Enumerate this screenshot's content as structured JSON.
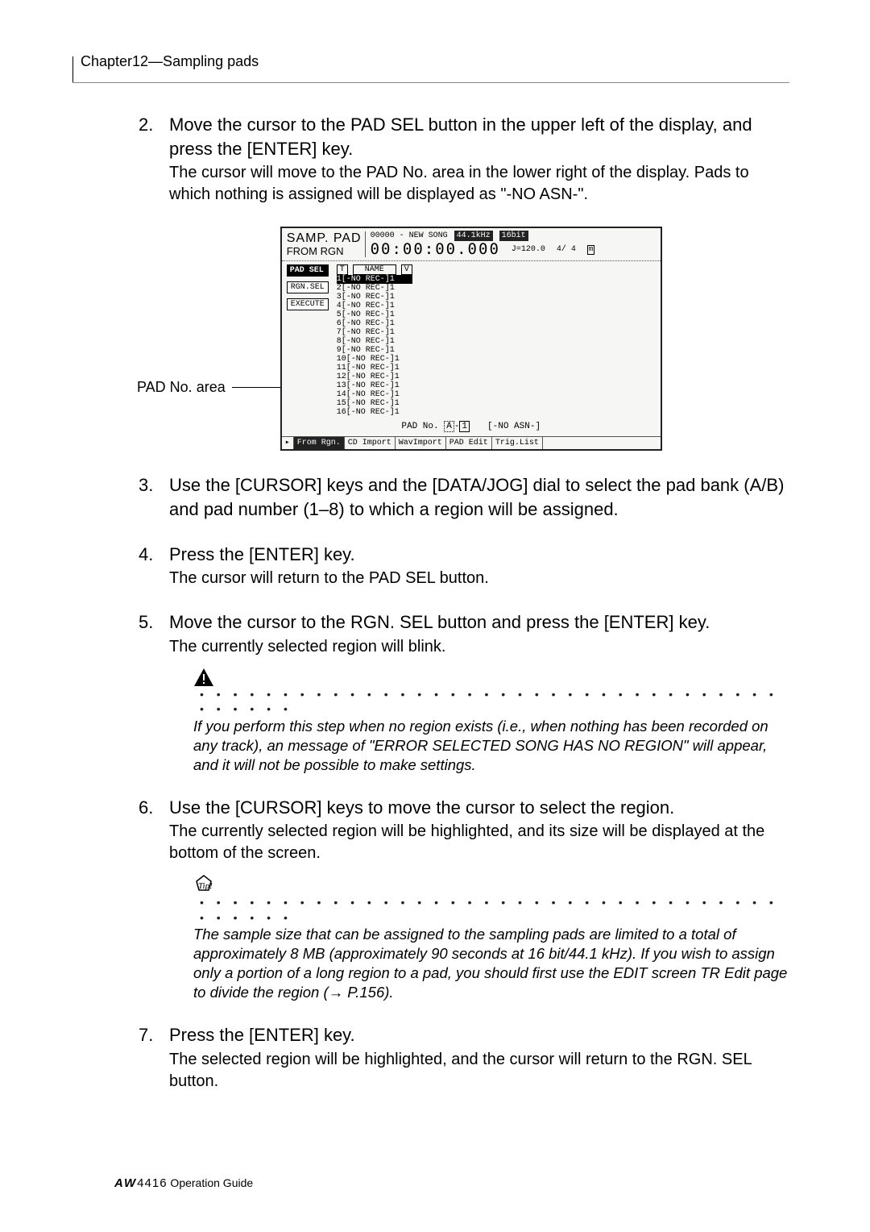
{
  "header": {
    "chapter": "Chapter12—Sampling pads"
  },
  "steps": {
    "s2": {
      "num": "2.",
      "head": "Move the cursor to the PAD SEL button in the upper left of the display, and press the [ENTER] key.",
      "body": "The cursor will move to the PAD No. area in the lower right of the display. Pads to which nothing is assigned will be displayed as \"-NO ASN-\"."
    },
    "s3": {
      "num": "3.",
      "head": "Use the [CURSOR] keys and the [DATA/JOG] dial to select the pad bank (A/B) and pad number (1–8) to which a region will be assigned."
    },
    "s4": {
      "num": "4.",
      "head": "Press the [ENTER] key.",
      "body": "The cursor will return to the PAD SEL button."
    },
    "s5": {
      "num": "5.",
      "head": "Move the cursor to the RGN. SEL button and press the [ENTER] key.",
      "body": "The currently selected region will blink."
    },
    "s6": {
      "num": "6.",
      "head": "Use the [CURSOR] keys to move the cursor to select the region.",
      "body": "The currently selected region will be highlighted, and its size will be displayed at the bottom of the screen."
    },
    "s7": {
      "num": "7.",
      "head": "Press the [ENTER] key.",
      "body": "The selected region will be highlighted, and the cursor will return to the RGN. SEL button."
    }
  },
  "callout": {
    "label": "PAD No. area"
  },
  "lcd": {
    "title_big": "SAMP. PAD",
    "title_small": "FROM RGN",
    "song": "00000 - NEW SONG",
    "time": "00:00:00.000",
    "rate": "44.1kHz",
    "bit": "16bit",
    "tempo": "J=120.0",
    "bars": "4/ 4",
    "btn_padsel": "PAD SEL",
    "btn_rgnsel": "RGN.SEL",
    "btn_execute": "EXECUTE",
    "col_t": "T",
    "col_name": "NAME",
    "col_v": "V",
    "rows": [
      " 1[-NO REC-]1",
      " 2[-NO REC-]1",
      " 3[-NO REC-]1",
      " 4[-NO REC-]1",
      " 5[-NO REC-]1",
      " 6[-NO REC-]1",
      " 7[-NO REC-]1",
      " 8[-NO REC-]1",
      " 9[-NO REC-]1",
      "10[-NO REC-]1",
      "11[-NO REC-]1",
      "12[-NO REC-]1",
      "13[-NO REC-]1",
      "14[-NO REC-]1",
      "15[-NO REC-]1",
      "16[-NO REC-]1"
    ],
    "padno_label": "PAD No.",
    "padno_bank": "A",
    "padno_num": "1",
    "padno_asn": "[-NO ASN-]",
    "tabs": [
      "From Rgn.",
      "CD Import",
      "WavImport",
      "PAD Edit",
      "Trig.List"
    ]
  },
  "notes": {
    "warn": "If you perform this step when no region exists (i.e., when nothing has been recorded on any track), an message of \"ERROR SELECTED SONG HAS NO REGION\" will appear, and it will not be possible to make settings.",
    "tip": "The sample size that can be assigned to the sampling pads are limited to a total of approximately 8 MB (approximately 90 seconds at 16 bit/44.1 kHz). If you wish to assign only a portion of a long region to a pad, you should first use the EDIT screen TR Edit page to divide the region (→ P.156)."
  },
  "footer": {
    "logo": "AW",
    "model": "4416",
    "doc": " Operation Guide"
  },
  "dots": "• • • • • • • • • • • • • • • • • • • • • • • • • • • • • • • • • • • • • • • • •"
}
